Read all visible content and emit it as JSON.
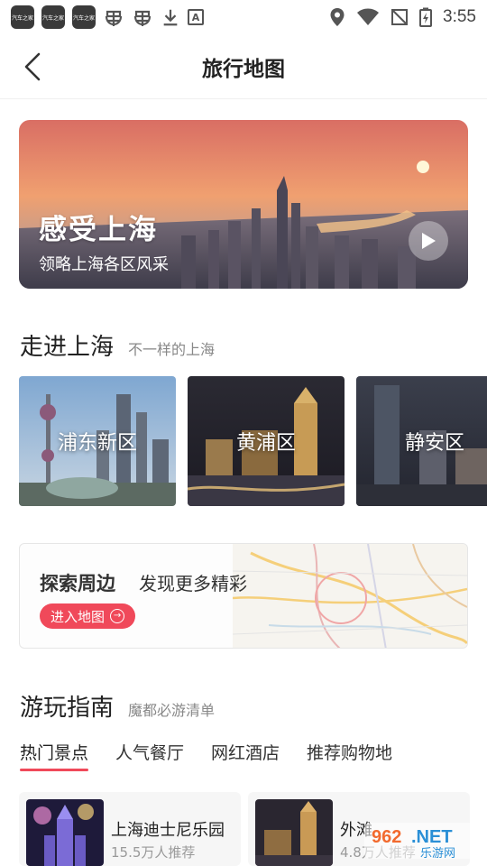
{
  "status_bar": {
    "app_icon_text": "汽车之家",
    "time": "3:55"
  },
  "header": {
    "title": "旅行地图"
  },
  "hero": {
    "title": "感受上海",
    "subtitle": "领略上海各区风采"
  },
  "section_districts": {
    "title": "走进上海",
    "subtitle": "不一样的上海",
    "items": [
      {
        "label": "浦东新区"
      },
      {
        "label": "黄浦区"
      },
      {
        "label": "静安区"
      }
    ]
  },
  "explore": {
    "title": "探索周边",
    "subtitle": "发现更多精彩",
    "button_label": "进入地图"
  },
  "section_guide": {
    "title": "游玩指南",
    "subtitle": "魔都必游清单",
    "tabs": [
      {
        "label": "热门景点",
        "active": true
      },
      {
        "label": "人气餐厅"
      },
      {
        "label": "网红酒店"
      },
      {
        "label": "推荐购物地"
      }
    ],
    "attractions": [
      {
        "name": "上海迪士尼乐园",
        "meta": "15.5万人推荐"
      },
      {
        "name": "外滩",
        "meta": "4.8万人推荐"
      }
    ]
  },
  "watermark": {
    "text_top": "962.NET",
    "text_bottom": "乐游网"
  },
  "colors": {
    "accent": "#f0495a",
    "hero_sky_top": "#e57a63",
    "hero_sky_bottom": "#f2a46a"
  }
}
